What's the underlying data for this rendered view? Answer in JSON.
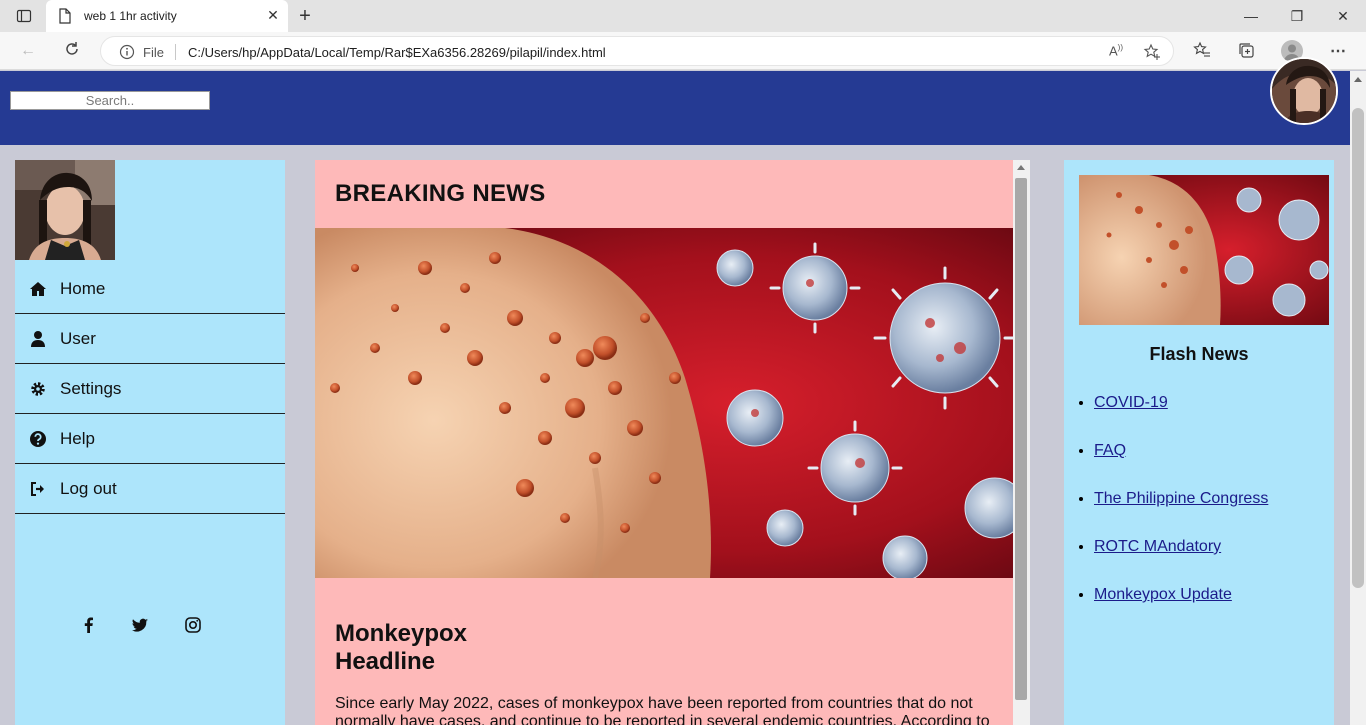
{
  "browser": {
    "tab_title": "web 1 1hr activity",
    "address_scheme": "File",
    "url": "C:/Users/hp/AppData/Local/Temp/Rar$EXa6356.28269/pilapil/index.html"
  },
  "header": {
    "search_placeholder": "Search.."
  },
  "sidebar": {
    "items": [
      {
        "label": "Home",
        "icon": "home-icon"
      },
      {
        "label": "User",
        "icon": "user-icon"
      },
      {
        "label": "Settings",
        "icon": "gear-icon"
      },
      {
        "label": "Help",
        "icon": "question-circle-icon"
      },
      {
        "label": "Log out",
        "icon": "sign-out-icon"
      }
    ],
    "social": [
      "facebook-icon",
      "twitter-icon",
      "instagram-icon"
    ]
  },
  "main": {
    "heading": "BREAKING NEWS",
    "headline": "Monkeypox Headline",
    "article": "Since early May 2022, cases of monkeypox have been reported from countries that do not normally have cases, and continue to be reported in several endemic countries. According to"
  },
  "flash_news": {
    "title": "Flash News",
    "links": [
      "COVID-19",
      "FAQ",
      "The Philippine Congress",
      "ROTC MAndatory",
      "Monkeypox Update"
    ]
  },
  "colors": {
    "header": "#253a93",
    "sidebar": "#ade5fb",
    "main": "#feb9b9",
    "link": "#1b1b8a"
  }
}
